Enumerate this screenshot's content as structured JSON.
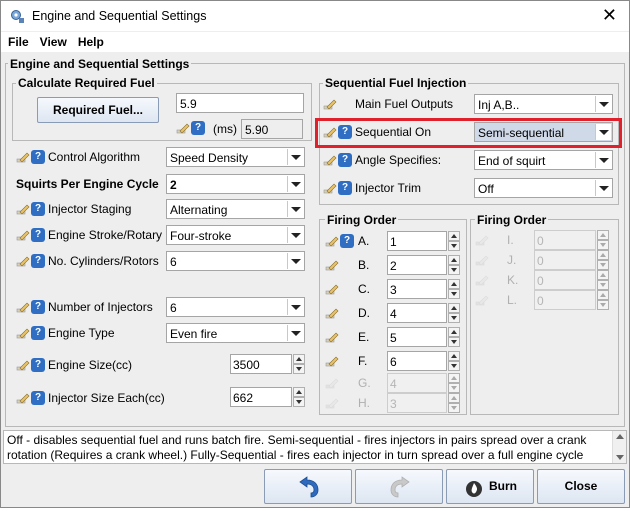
{
  "window": {
    "title": "Engine and Sequential Settings"
  },
  "menu": {
    "file": "File",
    "view": "View",
    "help": "Help"
  },
  "main_group": {
    "title": "Engine and Sequential Settings"
  },
  "calc_fuel": {
    "title": "Calculate Required Fuel",
    "button": "Required Fuel...",
    "value": "5.9",
    "ms_label": "(ms)",
    "ms_value": "5.90"
  },
  "left": {
    "control_algorithm": {
      "label": "Control Algorithm",
      "value": "Speed Density"
    },
    "squirts": {
      "label": "Squirts Per Engine Cycle",
      "value": "2"
    },
    "injector_staging": {
      "label": "Injector Staging",
      "value": "Alternating"
    },
    "engine_stroke": {
      "label": "Engine Stroke/Rotary",
      "value": "Four-stroke"
    },
    "cylinders": {
      "label": "No. Cylinders/Rotors",
      "value": "6"
    },
    "num_injectors": {
      "label": "Number of Injectors",
      "value": "6"
    },
    "engine_type": {
      "label": "Engine Type",
      "value": "Even fire"
    },
    "engine_size": {
      "label": "Engine Size(cc)",
      "value": "3500"
    },
    "injector_size": {
      "label": "Injector Size Each(cc)",
      "value": "662"
    }
  },
  "seq": {
    "title": "Sequential Fuel Injection",
    "main_outputs": {
      "label": "Main Fuel Outputs",
      "value": "Inj A,B.."
    },
    "sequential_on": {
      "label": "Sequential On",
      "value": "Semi-sequential"
    },
    "angle_specifies": {
      "label": "Angle Specifies:",
      "value": "End of squirt"
    },
    "injector_trim": {
      "label": "Injector Trim",
      "value": "Off"
    }
  },
  "firing_order_1": {
    "title": "Firing Order",
    "rows": [
      {
        "label": "A.",
        "value": "1",
        "enabled": true
      },
      {
        "label": "B.",
        "value": "2",
        "enabled": true
      },
      {
        "label": "C.",
        "value": "3",
        "enabled": true
      },
      {
        "label": "D.",
        "value": "4",
        "enabled": true
      },
      {
        "label": "E.",
        "value": "5",
        "enabled": true
      },
      {
        "label": "F.",
        "value": "6",
        "enabled": true
      },
      {
        "label": "G.",
        "value": "4",
        "enabled": false
      },
      {
        "label": "H.",
        "value": "3",
        "enabled": false
      }
    ]
  },
  "firing_order_2": {
    "title": "Firing Order",
    "rows": [
      {
        "label": "I.",
        "value": "0"
      },
      {
        "label": "J.",
        "value": "0"
      },
      {
        "label": "K.",
        "value": "0"
      },
      {
        "label": "L.",
        "value": "0"
      }
    ]
  },
  "status": {
    "line1": "Off - disables sequential fuel and runs batch fire. Semi-sequential - fires injectors in pairs spread over a crank",
    "line2": "rotation (Requires a crank wheel.) Fully-Sequential - fires each injector in turn spread over a full engine cycle"
  },
  "buttons": {
    "burn": "Burn",
    "close": "Close"
  },
  "colors": {
    "highlight": "#e0202a",
    "help_icon": "#2f6ec3"
  }
}
